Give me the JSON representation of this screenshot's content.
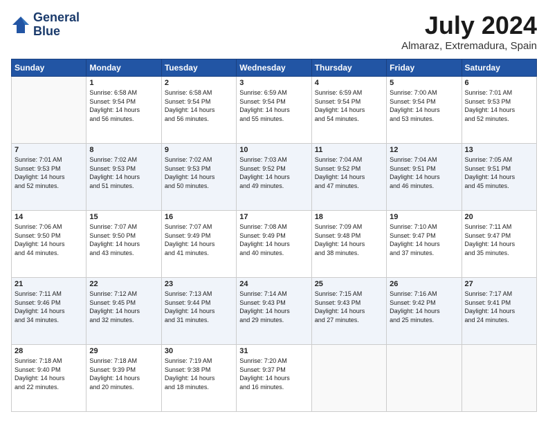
{
  "header": {
    "logo_line1": "General",
    "logo_line2": "Blue",
    "main_title": "July 2024",
    "subtitle": "Almaraz, Extremadura, Spain"
  },
  "days_of_week": [
    "Sunday",
    "Monday",
    "Tuesday",
    "Wednesday",
    "Thursday",
    "Friday",
    "Saturday"
  ],
  "weeks": [
    [
      {
        "day": "",
        "info": ""
      },
      {
        "day": "1",
        "info": "Sunrise: 6:58 AM\nSunset: 9:54 PM\nDaylight: 14 hours\nand 56 minutes."
      },
      {
        "day": "2",
        "info": "Sunrise: 6:58 AM\nSunset: 9:54 PM\nDaylight: 14 hours\nand 56 minutes."
      },
      {
        "day": "3",
        "info": "Sunrise: 6:59 AM\nSunset: 9:54 PM\nDaylight: 14 hours\nand 55 minutes."
      },
      {
        "day": "4",
        "info": "Sunrise: 6:59 AM\nSunset: 9:54 PM\nDaylight: 14 hours\nand 54 minutes."
      },
      {
        "day": "5",
        "info": "Sunrise: 7:00 AM\nSunset: 9:54 PM\nDaylight: 14 hours\nand 53 minutes."
      },
      {
        "day": "6",
        "info": "Sunrise: 7:01 AM\nSunset: 9:53 PM\nDaylight: 14 hours\nand 52 minutes."
      }
    ],
    [
      {
        "day": "7",
        "info": "Sunrise: 7:01 AM\nSunset: 9:53 PM\nDaylight: 14 hours\nand 52 minutes."
      },
      {
        "day": "8",
        "info": "Sunrise: 7:02 AM\nSunset: 9:53 PM\nDaylight: 14 hours\nand 51 minutes."
      },
      {
        "day": "9",
        "info": "Sunrise: 7:02 AM\nSunset: 9:53 PM\nDaylight: 14 hours\nand 50 minutes."
      },
      {
        "day": "10",
        "info": "Sunrise: 7:03 AM\nSunset: 9:52 PM\nDaylight: 14 hours\nand 49 minutes."
      },
      {
        "day": "11",
        "info": "Sunrise: 7:04 AM\nSunset: 9:52 PM\nDaylight: 14 hours\nand 47 minutes."
      },
      {
        "day": "12",
        "info": "Sunrise: 7:04 AM\nSunset: 9:51 PM\nDaylight: 14 hours\nand 46 minutes."
      },
      {
        "day": "13",
        "info": "Sunrise: 7:05 AM\nSunset: 9:51 PM\nDaylight: 14 hours\nand 45 minutes."
      }
    ],
    [
      {
        "day": "14",
        "info": "Sunrise: 7:06 AM\nSunset: 9:50 PM\nDaylight: 14 hours\nand 44 minutes."
      },
      {
        "day": "15",
        "info": "Sunrise: 7:07 AM\nSunset: 9:50 PM\nDaylight: 14 hours\nand 43 minutes."
      },
      {
        "day": "16",
        "info": "Sunrise: 7:07 AM\nSunset: 9:49 PM\nDaylight: 14 hours\nand 41 minutes."
      },
      {
        "day": "17",
        "info": "Sunrise: 7:08 AM\nSunset: 9:49 PM\nDaylight: 14 hours\nand 40 minutes."
      },
      {
        "day": "18",
        "info": "Sunrise: 7:09 AM\nSunset: 9:48 PM\nDaylight: 14 hours\nand 38 minutes."
      },
      {
        "day": "19",
        "info": "Sunrise: 7:10 AM\nSunset: 9:47 PM\nDaylight: 14 hours\nand 37 minutes."
      },
      {
        "day": "20",
        "info": "Sunrise: 7:11 AM\nSunset: 9:47 PM\nDaylight: 14 hours\nand 35 minutes."
      }
    ],
    [
      {
        "day": "21",
        "info": "Sunrise: 7:11 AM\nSunset: 9:46 PM\nDaylight: 14 hours\nand 34 minutes."
      },
      {
        "day": "22",
        "info": "Sunrise: 7:12 AM\nSunset: 9:45 PM\nDaylight: 14 hours\nand 32 minutes."
      },
      {
        "day": "23",
        "info": "Sunrise: 7:13 AM\nSunset: 9:44 PM\nDaylight: 14 hours\nand 31 minutes."
      },
      {
        "day": "24",
        "info": "Sunrise: 7:14 AM\nSunset: 9:43 PM\nDaylight: 14 hours\nand 29 minutes."
      },
      {
        "day": "25",
        "info": "Sunrise: 7:15 AM\nSunset: 9:43 PM\nDaylight: 14 hours\nand 27 minutes."
      },
      {
        "day": "26",
        "info": "Sunrise: 7:16 AM\nSunset: 9:42 PM\nDaylight: 14 hours\nand 25 minutes."
      },
      {
        "day": "27",
        "info": "Sunrise: 7:17 AM\nSunset: 9:41 PM\nDaylight: 14 hours\nand 24 minutes."
      }
    ],
    [
      {
        "day": "28",
        "info": "Sunrise: 7:18 AM\nSunset: 9:40 PM\nDaylight: 14 hours\nand 22 minutes."
      },
      {
        "day": "29",
        "info": "Sunrise: 7:18 AM\nSunset: 9:39 PM\nDaylight: 14 hours\nand 20 minutes."
      },
      {
        "day": "30",
        "info": "Sunrise: 7:19 AM\nSunset: 9:38 PM\nDaylight: 14 hours\nand 18 minutes."
      },
      {
        "day": "31",
        "info": "Sunrise: 7:20 AM\nSunset: 9:37 PM\nDaylight: 14 hours\nand 16 minutes."
      },
      {
        "day": "",
        "info": ""
      },
      {
        "day": "",
        "info": ""
      },
      {
        "day": "",
        "info": ""
      }
    ]
  ]
}
